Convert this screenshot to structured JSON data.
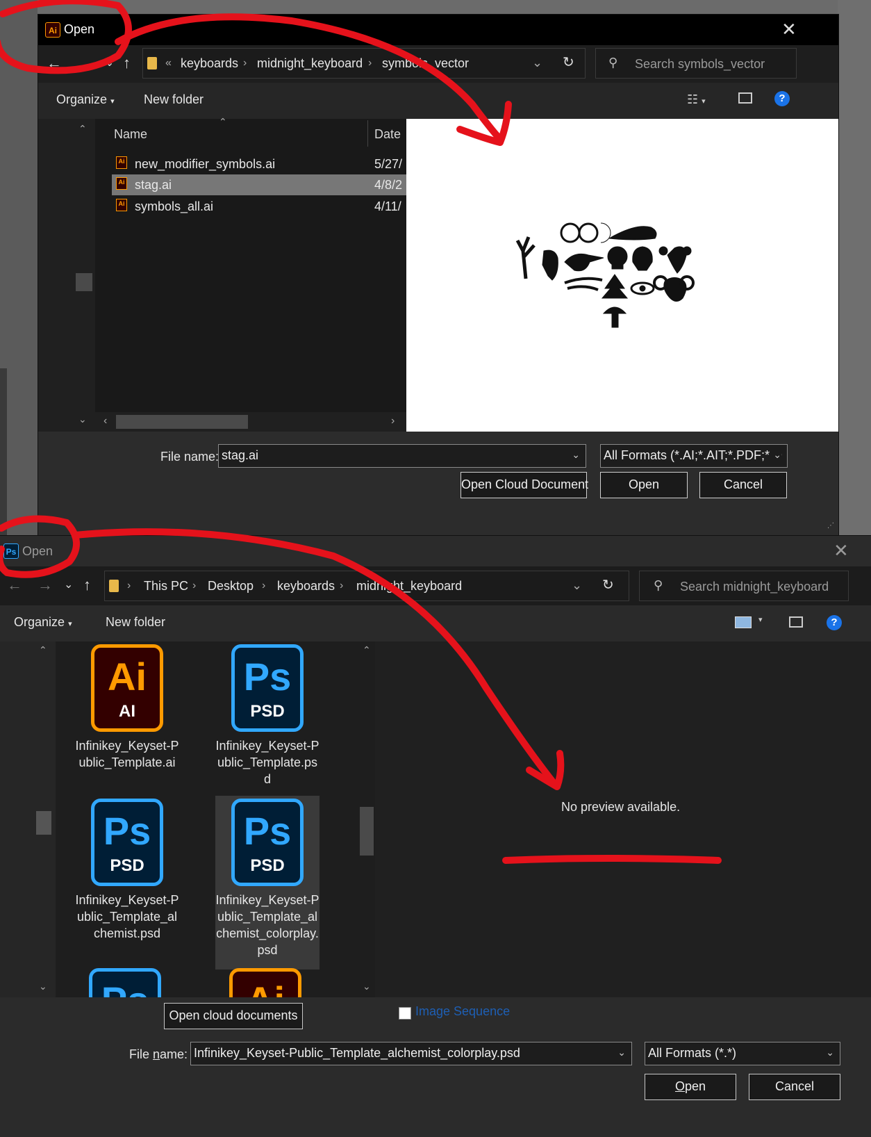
{
  "dialog_top": {
    "app_badge": "Ai",
    "title": "Open",
    "breadcrumb": {
      "overflow": "«",
      "items": [
        "keyboards",
        "midnight_keyboard",
        "symbols_vector"
      ]
    },
    "search_placeholder": "Search symbols_vector",
    "toolbar": {
      "organize": "Organize",
      "new_folder": "New folder",
      "help": "?"
    },
    "columns": {
      "name": "Name",
      "date": "Date"
    },
    "files": [
      {
        "name": "new_modifier_symbols.ai",
        "date": "5/27/",
        "selected": false
      },
      {
        "name": "stag.ai",
        "date": "4/8/2",
        "selected": true
      },
      {
        "name": "symbols_all.ai",
        "date": "4/11/",
        "selected": false
      }
    ],
    "file_name_label": "File name:",
    "file_name_value": "stag.ai",
    "format_value": "All Formats (*.AI;*.AIT;*.PDF;*.D",
    "buttons": {
      "cloud": "Open Cloud Document",
      "open": "Open",
      "cancel": "Cancel"
    }
  },
  "dialog_bottom": {
    "app_badge": "Ps",
    "title": "Open",
    "breadcrumb": {
      "items": [
        "This PC",
        "Desktop",
        "keyboards",
        "midnight_keyboard"
      ]
    },
    "search_placeholder": "Search midnight_keyboard",
    "toolbar": {
      "organize": "Organize",
      "new_folder": "New folder",
      "help": "?"
    },
    "files": [
      {
        "type": "AI",
        "big": "Ai",
        "label": "Infinikey_Keyset-Public_Template.ai",
        "selected": false
      },
      {
        "type": "PSD",
        "big": "Ps",
        "label": "Infinikey_Keyset-Public_Template.psd",
        "selected": false
      },
      {
        "type": "PSD",
        "big": "Ps",
        "label": "Infinikey_Keyset-Public_Template_alchemist.psd",
        "selected": false
      },
      {
        "type": "PSD",
        "big": "Ps",
        "label": "Infinikey_Keyset-Public_Template_alchemist_colorplay.psd",
        "selected": true
      }
    ],
    "preview_text": "No preview available.",
    "cloud_button": "Open cloud documents",
    "image_sequence_label": "Image Sequence",
    "file_name_label_prefix": "File ",
    "file_name_label_key": "n",
    "file_name_label_suffix": "ame:",
    "file_name_value": "Infinikey_Keyset-Public_Template_alchemist_colorplay.psd",
    "format_value": "All Formats (*.*)",
    "buttons": {
      "open_key": "O",
      "open_rest": "pen",
      "cancel": "Cancel"
    }
  },
  "colors": {
    "annotation_red": "#e5121b",
    "ai_orange": "#ff9a00",
    "ps_blue": "#31a8ff",
    "help_blue": "#1a73e8"
  }
}
